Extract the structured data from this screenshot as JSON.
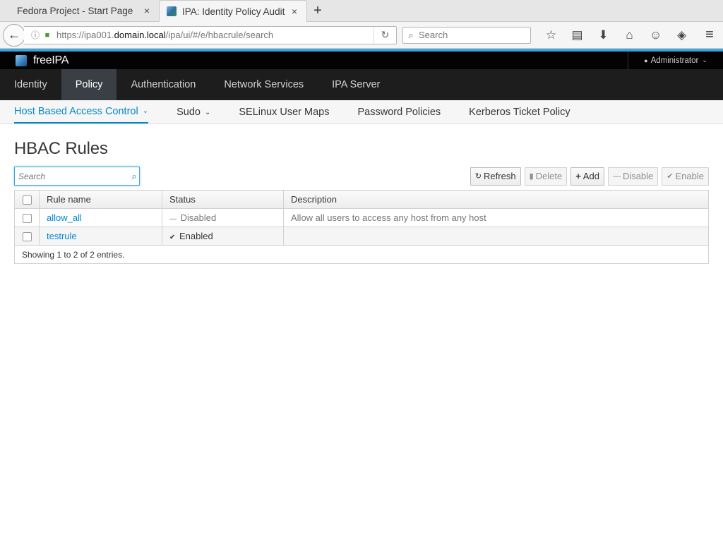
{
  "browser": {
    "tabs": [
      {
        "title": "Fedora Project - Start Page",
        "active": false
      },
      {
        "title": "IPA: Identity Policy Audit",
        "active": true
      }
    ],
    "url_prefix": "https://ipa001.",
    "url_domain": "domain.local",
    "url_suffix": "/ipa/ui/#/e/hbacrule/search",
    "search_placeholder": "Search",
    "tab_close_icon": "×",
    "new_tab_icon": "+",
    "back_icon": "←",
    "reload_icon": "↻",
    "info_icon": "ⓘ",
    "lock_icon": "🔒",
    "magnifier_icon": "⌕",
    "toolbar_icons": {
      "bookmark": "☆",
      "reading_list": "▤",
      "download": "⬇",
      "home": "⌂",
      "chat": "☺",
      "pocket": "◈"
    },
    "menu_icon": "≡"
  },
  "app": {
    "brand": "freeIPA",
    "user": "Administrator",
    "user_icon": "👤",
    "user_caret": "⌄",
    "primary_nav": [
      "Identity",
      "Policy",
      "Authentication",
      "Network Services",
      "IPA Server"
    ],
    "primary_active": "Policy",
    "secondary_nav": {
      "hbac": "Host Based Access Control",
      "sudo": "Sudo",
      "selinux": "SELinux User Maps",
      "password": "Password Policies",
      "kerberos": "Kerberos Ticket Policy",
      "dropdown_icon": "⌄"
    },
    "accent_color": "#39a5dc",
    "link_color": "#0088ce"
  },
  "page": {
    "title": "HBAC Rules",
    "filter_placeholder": "Search",
    "filter_icon": "⌕",
    "buttons": {
      "refresh": "Refresh",
      "refresh_icon": "↻",
      "delete": "Delete",
      "delete_icon": "🗑",
      "add": "Add",
      "add_icon": "+",
      "disable": "Disable",
      "disable_icon": "—",
      "enable": "Enable",
      "enable_icon": "✔"
    },
    "table": {
      "headers": {
        "name": "Rule name",
        "status": "Status",
        "description": "Description"
      },
      "rows": [
        {
          "name": "allow_all",
          "status": "Disabled",
          "status_icon": "—",
          "description": "Allow all users to access any host from any host"
        },
        {
          "name": "testrule",
          "status": "Enabled",
          "status_icon": "✔",
          "description": ""
        }
      ],
      "footer": "Showing 1 to 2 of 2 entries."
    }
  }
}
